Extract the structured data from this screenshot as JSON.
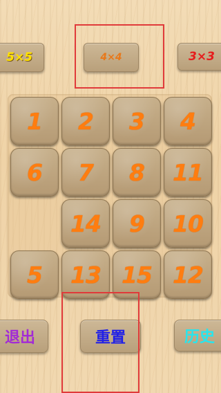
{
  "modes": [
    {
      "label": "5×5"
    },
    {
      "label": "4×4"
    },
    {
      "label": "3×3"
    }
  ],
  "tiles": [
    "1",
    "2",
    "3",
    "4",
    "6",
    "7",
    "8",
    "11",
    "",
    "14",
    "9",
    "10",
    "5",
    "13",
    "15",
    "12"
  ],
  "buttons": {
    "exit": "退出",
    "reset": "重置",
    "history": "历史"
  },
  "colors": {
    "tile_number": "#ff7d10",
    "mode_5x5": "#ffe100",
    "mode_4x4": "#e8781a",
    "mode_3x3": "#e61d1d",
    "exit": "#a22ad6",
    "reset": "#1f1fe8",
    "history": "#26e6ee",
    "highlight": "#e03a3a"
  }
}
